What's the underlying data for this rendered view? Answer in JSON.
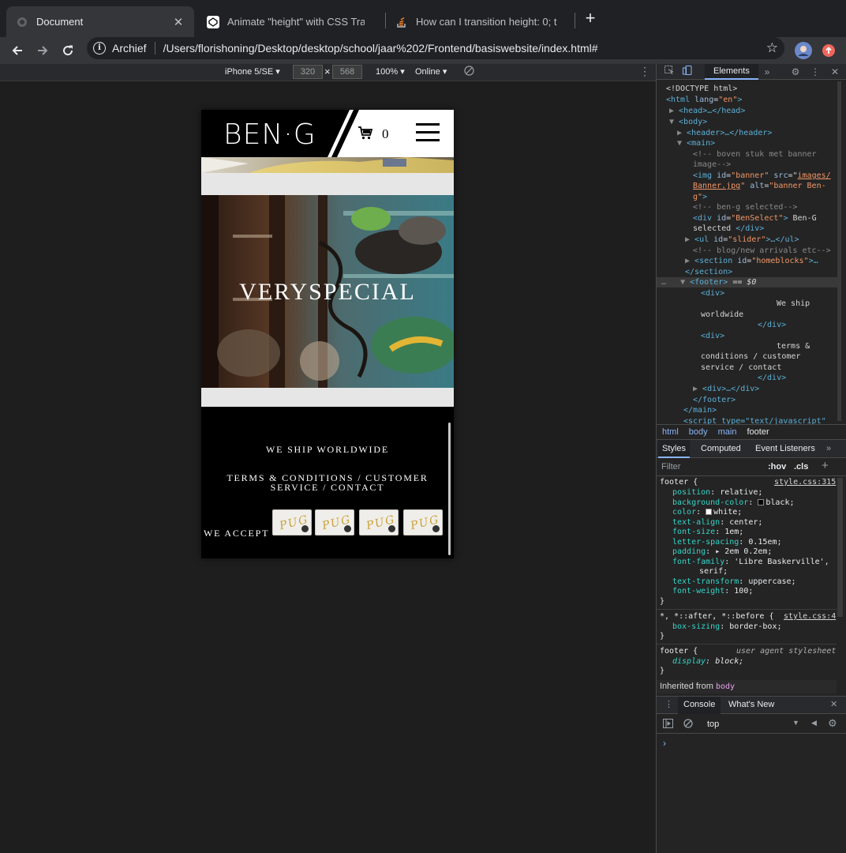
{
  "browser": {
    "tabs": [
      {
        "title": "Document",
        "active": true
      },
      {
        "title": "Animate \"height\" with CSS Tran",
        "active": false
      },
      {
        "title": "How can I transition height: 0; t",
        "active": false
      }
    ],
    "omnibox": {
      "scheme": "Archief",
      "url": "/Users/florishoning/Desktop/desktop/school/jaar%202/Frontend/basiswebsite/index.html#"
    }
  },
  "device_toolbar": {
    "device": "iPhone 5/SE",
    "width": "320",
    "times": "×",
    "height": "568",
    "zoom": "100%",
    "network": "Online"
  },
  "site": {
    "logo": "BEN·G",
    "cart_count": "0",
    "slider_text": "VERYSPECIAL",
    "footer": {
      "ship": "We ship worldwide",
      "terms": "terms & conditions / customer service / contact",
      "accept": "We accept",
      "cards": [
        "Pug card",
        "Pug card",
        "Pug card",
        "Pug card"
      ]
    }
  },
  "devtools": {
    "tabs": {
      "elements": "Elements"
    },
    "dom": {
      "doctype": "<!DOCTYPE html>",
      "html_open": "<html",
      "lang_attr": "lang",
      "lang_val": "\"en\"",
      "head": "<head>…</head>",
      "body_open": "<body>",
      "header": "<header>…</header>",
      "main_open": "<main>",
      "comment1a": "<!-- boven stuk met banner",
      "comment1b": "image-->",
      "img_tag": "<img",
      "img_id_attr": "id",
      "img_id_val": "\"banner\"",
      "img_src_attr": "src",
      "img_src_val1": "images/",
      "img_src_val2": "Banner.jpg",
      "img_alt_attr": "alt",
      "img_alt_val1": "\"banner Ben-",
      "img_alt_val2": "g\"",
      "comment2": "<!-- ben-g selected-->",
      "div_tag": "<div",
      "div_id_val": "\"BenSelect\"",
      "div_text": "Ben-G",
      "div_text2": "selected",
      "div_close": "</div>",
      "ul_tag": "<ul",
      "ul_id_val": "\"slider\"",
      "ul_rest": ">…</ul>",
      "comment3": "<!-- blog/new arrivals etc-->",
      "section_tag": "<section",
      "section_id_val": "\"homeblocks\"",
      "section_rest": ">…",
      "section_close": "</section>",
      "footer_open": "<footer>",
      "footer_eq": "== $0",
      "div_open": "<div>",
      "ship_text1": "We ship",
      "ship_text2": "worldwide",
      "terms1": "terms &",
      "terms2": "conditions / customer",
      "terms3": "service / contact",
      "div_collapsed": "<div>…</div>",
      "footer_close": "</footer>",
      "main_close": "</main>",
      "script_line": "<script type=\"text/javascript\""
    },
    "breadcrumbs": [
      "html",
      "body",
      "main",
      "footer"
    ],
    "styles_tabs": [
      "Styles",
      "Computed",
      "Event Listeners"
    ],
    "filter_placeholder": "Filter",
    "hov": ":hov",
    "cls": ".cls",
    "rules": {
      "footer_selector": "footer {",
      "footer_src": "style.css:315",
      "props": [
        {
          "n": "position",
          "v": "relative;"
        },
        {
          "n": "background-color",
          "v": "black;"
        },
        {
          "n": "color",
          "v": "white;"
        },
        {
          "n": "text-align",
          "v": "center;"
        },
        {
          "n": "font-size",
          "v": "1em;"
        },
        {
          "n": "letter-spacing",
          "v": "0.15em;"
        },
        {
          "n": "padding",
          "v": "2em 0.2em;"
        },
        {
          "n": "font-family",
          "v": "'Libre Baskerville',"
        },
        {
          "n": "text-transform",
          "v": "uppercase;"
        },
        {
          "n": "font-weight",
          "v": "100;"
        }
      ],
      "font_family_cont": "serif;",
      "close": "}",
      "universal_selector": "*, *::after, *::before {",
      "universal_src": "style.css:4",
      "box_sizing_n": "box-sizing",
      "box_sizing_v": "border-box;",
      "ua_selector": "footer {",
      "ua_src": "user agent stylesheet",
      "display_n": "display",
      "display_v": "block;",
      "inherited_label": "Inherited from",
      "inherited_from": "body"
    },
    "console": {
      "tab_console": "Console",
      "tab_whatsnew": "What's New",
      "context": "top",
      "prompt": "›"
    }
  },
  "colors": {
    "accent": "#8ab4f8",
    "footer_bg": "#000000",
    "tag": "#5db0d7",
    "prop": "#35d4c7"
  }
}
